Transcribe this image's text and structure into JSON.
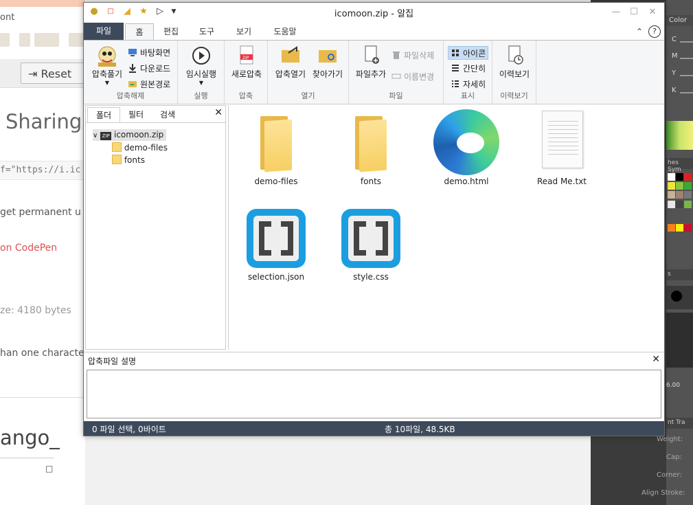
{
  "background_left": {
    "tab_fragment": "ont",
    "reset_label": "Reset",
    "sharing_heading": "Sharing",
    "code_fragment": "f=\"https://i.ic",
    "permanent_text": "get permanent u",
    "codepen_text": "on CodePen",
    "size_text": "ze: 4180 bytes",
    "than_text": "han one characte",
    "django_fragment": "ango_",
    "glyph": "□"
  },
  "background_right": {
    "color_tab": "Color",
    "channels": [
      "C",
      "M",
      "Y",
      "K"
    ],
    "swatches_tab": "hes",
    "sym_tab": "Sym",
    "brush_tab": "s",
    "value": "6.00",
    "tabs_bottom": [
      "nt",
      "Tra"
    ],
    "labels": [
      "Weight:",
      "Cap:",
      "Corner:",
      "Align Stroke:"
    ]
  },
  "window": {
    "title": "icomoon.zip - 알집",
    "controls": {
      "minimize": "—",
      "maximize": "☐",
      "close": "✕"
    },
    "ribbon_tabs": [
      "파일",
      "홈",
      "편집",
      "도구",
      "보기",
      "도움말"
    ],
    "ribbon_right": {
      "collapse": "⌃",
      "help": "?"
    },
    "groups": {
      "extract": {
        "label": "압축해제",
        "big": "압축풀기",
        "small": [
          "바탕화면",
          "다운로드",
          "원본경로"
        ]
      },
      "run": {
        "label": "실행",
        "big": "임시실행"
      },
      "compress": {
        "label": "압축",
        "big": "새로압축"
      },
      "open": {
        "label": "열기",
        "big1": "압축열기",
        "big2": "찾아가기"
      },
      "file": {
        "label": "파일",
        "big": "파일추가",
        "small": [
          "파일삭제",
          "이름변경"
        ]
      },
      "view": {
        "label": "표시",
        "small": [
          "아이콘",
          "간단히",
          "자세히"
        ]
      },
      "history": {
        "label": "이력보기",
        "big": "이력보기"
      }
    },
    "panel": {
      "tabs": [
        "폴더",
        "필터",
        "검색"
      ],
      "close": "✕",
      "root": "icomoon.zip",
      "children": [
        "demo-files",
        "fonts"
      ]
    },
    "files": [
      {
        "name": "demo-files",
        "icon": "folder-icon"
      },
      {
        "name": "fonts",
        "icon": "folder-icon"
      },
      {
        "name": "demo.html",
        "icon": "edge-icon"
      },
      {
        "name": "Read Me.txt",
        "icon": "text-file-icon"
      },
      {
        "name": "selection.json",
        "icon": "brackets-icon"
      },
      {
        "name": "style.css",
        "icon": "brackets-icon"
      }
    ],
    "description": {
      "label": "압축파일 설명",
      "close": "✕"
    },
    "status": {
      "left": "0 파일 선택,  0바이트",
      "right": "총 10파일,  48.5KB"
    }
  }
}
